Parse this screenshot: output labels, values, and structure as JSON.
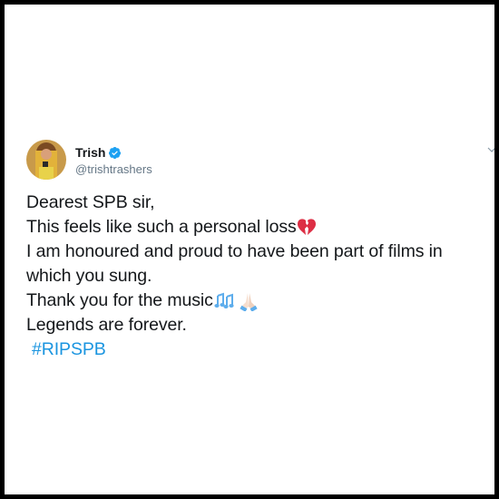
{
  "tweet": {
    "author": {
      "display_name": "Trish",
      "handle": "@trishtrashers",
      "avatar_icon": "profile-photo",
      "verified_icon": "verified-badge-icon",
      "verified_color": "#1da1f2"
    },
    "lines": [
      "Dearest SPB sir,",
      "This feels like such a personal loss",
      "I am honoured and proud to have been part of films in",
      "which you sung.",
      "Thank you for the music",
      "Legends are forever."
    ],
    "emojis": {
      "broken_heart": "broken-heart-emoji",
      "music_notes": "musical-notes-emoji",
      "folded_hands": "folded-hands-emoji"
    },
    "hashtag": "#RIPSPB",
    "hashtag_color": "#1b95e0",
    "menu_icon": "chevron-down-icon"
  }
}
